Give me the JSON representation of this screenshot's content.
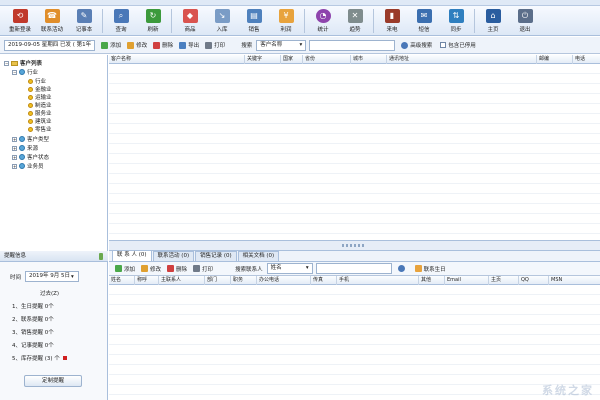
{
  "toolbar": {
    "buttons": [
      {
        "label": "重新登录",
        "icon": "relogin-icon",
        "color": "#c0392b"
      },
      {
        "label": "联系活动",
        "icon": "contact-activity-icon",
        "color": "#e08e2b"
      },
      {
        "label": "记事本",
        "icon": "notepad-icon",
        "color": "#5a7fb5"
      },
      {
        "label": "查询",
        "icon": "search-icon",
        "color": "#4a78b8"
      },
      {
        "label": "刷新",
        "icon": "refresh-icon",
        "color": "#3c9a3c"
      },
      {
        "label": "商品",
        "icon": "goods-icon",
        "color": "#d9534f"
      },
      {
        "label": "入库",
        "icon": "stock-in-icon",
        "color": "#7a9cc6"
      },
      {
        "label": "销售",
        "icon": "sales-icon",
        "color": "#4f81bd"
      },
      {
        "label": "利润",
        "icon": "profit-icon",
        "color": "#e8a33d"
      },
      {
        "label": "统计",
        "icon": "statistics-icon",
        "color": "#8e44ad"
      },
      {
        "label": "趋势",
        "icon": "trend-icon",
        "color": "#7f8c8d"
      },
      {
        "label": "来电",
        "icon": "incoming-call-icon",
        "color": "#9a3b2a"
      },
      {
        "label": "短信",
        "icon": "sms-icon",
        "color": "#3b6fb0"
      },
      {
        "label": "同步",
        "icon": "sync-icon",
        "color": "#2f7fbf"
      },
      {
        "label": "主页",
        "icon": "home-icon",
        "color": "#2a5d9f"
      },
      {
        "label": "退出",
        "icon": "exit-icon",
        "color": "#5b6e8a"
      }
    ]
  },
  "subtoolbar": {
    "date": "2019-09-05 星期四 已发 ( 第1年",
    "add": "添加",
    "edit": "修改",
    "delete": "删除",
    "export": "导出",
    "print": "打印",
    "search_label": "搜索",
    "search_field": "客户名称",
    "advanced": "高级搜索",
    "include_deleted": "包含已停用"
  },
  "tree": {
    "root": "客户列表",
    "industry": "行业",
    "leaves": [
      "行业",
      "金融业",
      "运输业",
      "制造业",
      "服务业",
      "建筑业",
      "零售业"
    ],
    "groups": [
      "客户类型",
      "来源",
      "客户状态",
      "业务员"
    ]
  },
  "main_grid": {
    "columns": [
      "客户名称",
      "关键字",
      "国家",
      "省份",
      "城市",
      "通讯地址",
      "邮编",
      "电话"
    ]
  },
  "tabs": [
    {
      "label": "联 系 人 (0)"
    },
    {
      "label": "联系活动 (0)"
    },
    {
      "label": "销售记录 (0)"
    },
    {
      "label": "相关文档 (0)"
    }
  ],
  "bottom_toolbar": {
    "add": "添加",
    "edit": "修改",
    "delete": "删除",
    "print": "打印",
    "search_label": "搜索联系人",
    "search_field": "姓名",
    "birthday": "联系生日"
  },
  "bottom_grid": {
    "columns": [
      "姓名",
      "称呼",
      "主联系人",
      "部门",
      "职务",
      "办公电话",
      "传真",
      "手机",
      "其他",
      "Email",
      "主页",
      "QQ",
      "MSN"
    ]
  },
  "reminder": {
    "title": "提醒信息",
    "time_label": "时间",
    "date": "2019年 9月 5日",
    "overdue": "过去(Z)",
    "items": [
      "1、生日提醒 0个",
      "2、联系提醒 0个",
      "3、销售提醒 0个",
      "4、记事提醒 0个",
      "5、库存提醒 (3) 个"
    ],
    "button": "定制提醒"
  },
  "watermark": "系统之家"
}
